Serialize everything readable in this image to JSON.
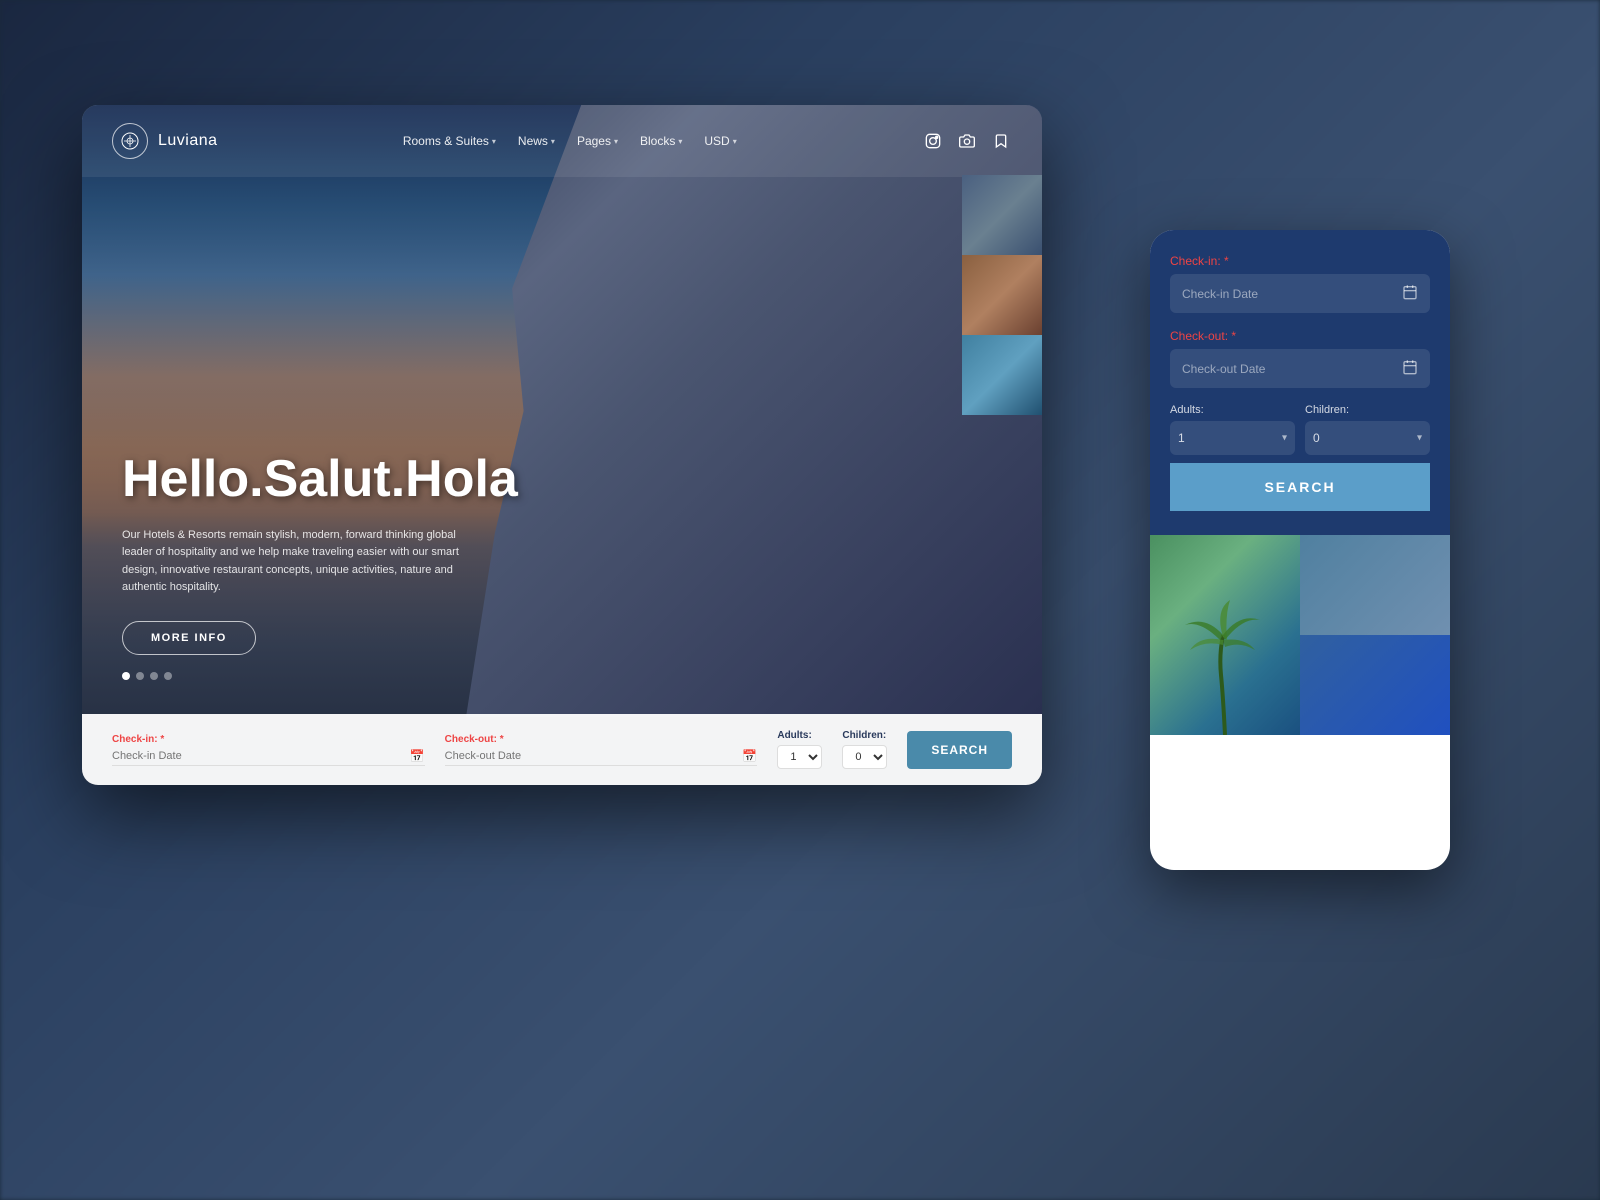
{
  "brand": {
    "name": "Luviana"
  },
  "nav": {
    "items": [
      {
        "label": "Rooms & Suites",
        "hasDropdown": true
      },
      {
        "label": "News",
        "hasDropdown": true
      },
      {
        "label": "Pages",
        "hasDropdown": true
      },
      {
        "label": "Blocks",
        "hasDropdown": true
      },
      {
        "label": "USD",
        "hasDropdown": true
      }
    ],
    "icons": [
      "instagram",
      "camera",
      "bookmark"
    ]
  },
  "hero": {
    "title": "Hello.Salut.Hola",
    "description": "Our Hotels & Resorts remain stylish, modern, forward thinking global leader of hospitality and we help make traveling easier with our smart design, innovative restaurant concepts, unique activities, nature and authentic hospitality.",
    "cta_label": "MORE INFO"
  },
  "search_bar": {
    "checkin_label": "Check-in:",
    "checkin_placeholder": "Check-in Date",
    "checkout_label": "Check-out:",
    "checkout_placeholder": "Check-out Date",
    "adults_label": "Adults:",
    "adults_default": "1",
    "children_label": "Children:",
    "children_default": "0",
    "search_label": "SEARCH"
  },
  "mobile_booking": {
    "checkin_label": "Check-in: *",
    "checkin_placeholder": "Check-in Date",
    "checkout_label": "Check-out: *",
    "checkout_placeholder": "Check-out Date",
    "adults_label": "Adults:",
    "adults_default": "1",
    "children_label": "Children:",
    "children_default": "0",
    "search_label": "SEARCH"
  },
  "carousel_dots": 4,
  "active_dot": 0
}
